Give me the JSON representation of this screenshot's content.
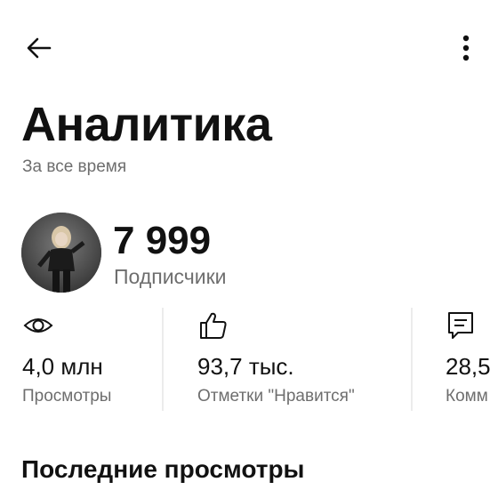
{
  "header": {
    "back_icon": "arrow-left-icon",
    "menu_icon": "more-vertical-icon",
    "title": "Аналитика",
    "period": "За все время"
  },
  "channel": {
    "subscribers_count": "7 999",
    "subscribers_label": "Подписчики"
  },
  "stats": [
    {
      "icon": "eye-icon",
      "value": "4,0 млн",
      "label": "Просмотры"
    },
    {
      "icon": "thumbs-up-icon",
      "value": "93,7 тыс.",
      "label": "Отметки \"Нравится\""
    },
    {
      "icon": "comment-icon",
      "value": "28,5",
      "label": "Комм"
    }
  ],
  "recent": {
    "title": "Последние просмотры"
  },
  "colors": {
    "text": "#111111",
    "secondary_text": "#6e6e6e",
    "divider": "#ececec",
    "background": "#ffffff"
  }
}
